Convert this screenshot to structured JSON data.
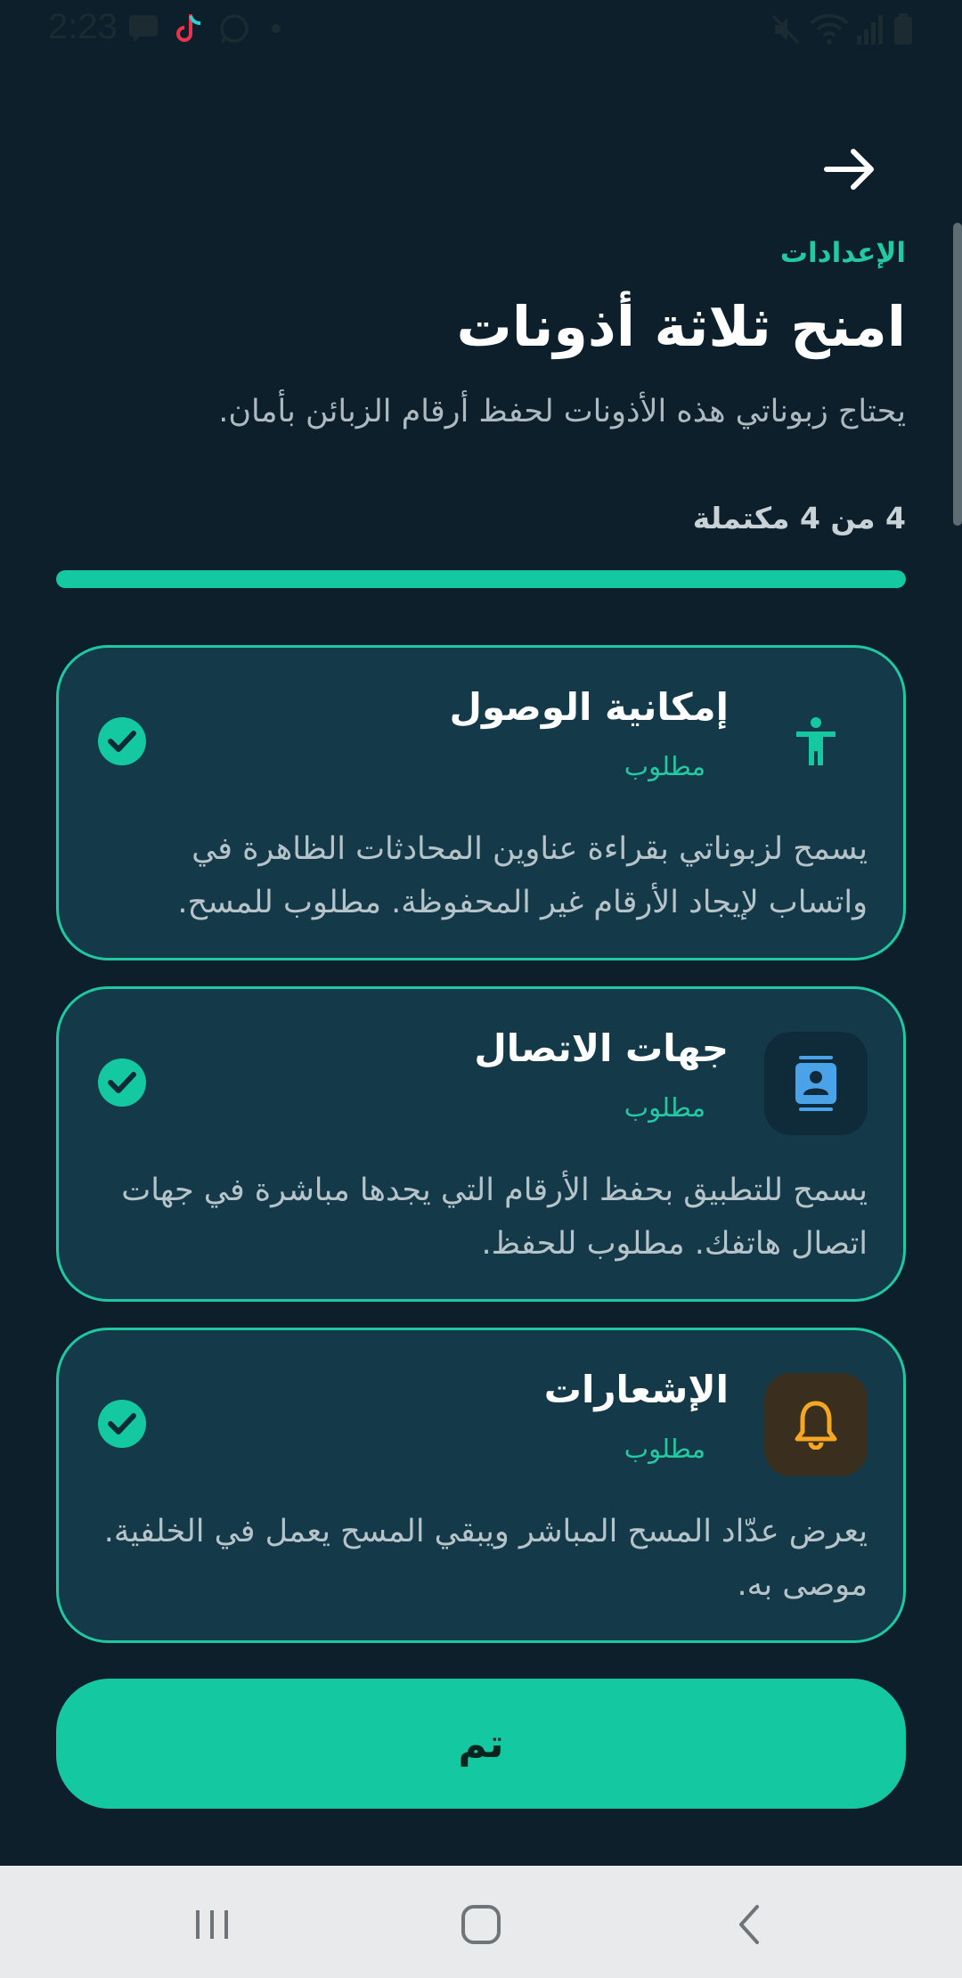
{
  "status_bar": {
    "time": "2:23"
  },
  "header": {
    "eyebrow": "الإعدادات",
    "title": "امنح ثلاثة أذونات",
    "subtitle": "يحتاج زبوناتي هذه الأذونات لحفظ أرقام الزبائن بأمان."
  },
  "progress": {
    "label": "4 من 4 مكتملة",
    "completed": 4,
    "total": 4
  },
  "permissions": [
    {
      "title": "إمكانية الوصول",
      "badge": "مطلوب",
      "description": "يسمح لزبوناتي بقراءة عناوين المحادثات الظاهرة في واتساب لإيجاد الأرقام غير المحفوظة. مطلوب للمسح.",
      "icon": "accessibility-icon",
      "granted": true
    },
    {
      "title": "جهات الاتصال",
      "badge": "مطلوب",
      "description": "يسمح للتطبيق بحفظ الأرقام التي يجدها مباشرة في جهات اتصال هاتفك. مطلوب للحفظ.",
      "icon": "contacts-icon",
      "granted": true
    },
    {
      "title": "الإشعارات",
      "badge": "مطلوب",
      "description": "يعرض عدّاد المسح المباشر ويبقي المسح يعمل في الخلفية. موصى به.",
      "icon": "bell-icon",
      "granted": true
    }
  ],
  "actions": {
    "done_label": "تم"
  },
  "colors": {
    "background": "#0c1f2a",
    "accent": "#14c9a2",
    "card": "#143a49",
    "notification_icon_bg": "#3a2e1e",
    "notification_icon": "#f5a623"
  }
}
